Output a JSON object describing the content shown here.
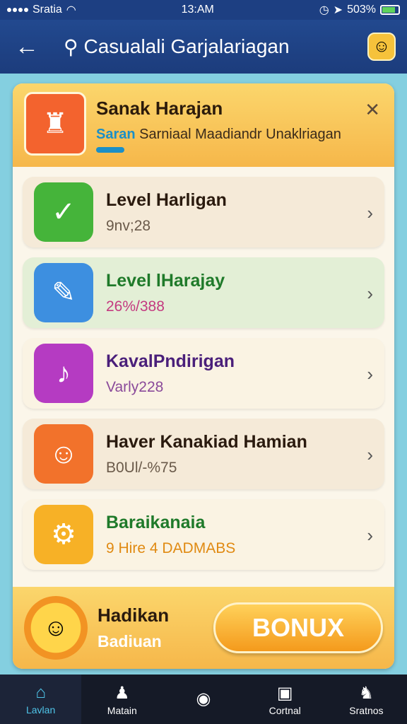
{
  "status_bar": {
    "carrier": "Sratia",
    "time": "13:AM",
    "battery": "503%"
  },
  "app_bar": {
    "title": "Casualali Garjalariagan"
  },
  "banner": {
    "title": "Sanak Harajan",
    "subtitle_accent": "Saran",
    "subtitle": "Sarniaal Maadiandr Unaklriagan"
  },
  "list": {
    "items": [
      {
        "title": "Level Harligan",
        "subtitle": "9nv;28",
        "bg": "#f5ead8",
        "icon_bg": "#45b43a",
        "title_color": "#2a1a0e",
        "sub_color": "#6a5a4a"
      },
      {
        "title": "Level lHarajay",
        "subtitle": "26%/388",
        "bg": "#e3efd6",
        "icon_bg": "#3d8fe0",
        "title_color": "#1f7a2a",
        "sub_color": "#c43a80"
      },
      {
        "title": "KavalPndirigan",
        "subtitle": "Varly228",
        "bg": "#faf3e3",
        "icon_bg": "#b53bc2",
        "title_color": "#4a1f7a",
        "sub_color": "#8a4a9a"
      },
      {
        "title": "Haver Kanakiad Hamian",
        "subtitle": "B0Ul/-%75",
        "bg": "#f5ead8",
        "icon_bg": "#f2722b",
        "title_color": "#2a1a0e",
        "sub_color": "#6a5a4a"
      },
      {
        "title": "Baraikanaia",
        "subtitle": "9 Hire 4 DADMABS",
        "bg": "#faf3e3",
        "icon_bg": "#f7b126",
        "title_color": "#1f7a2a",
        "sub_color": "#e08a12"
      }
    ]
  },
  "bonus": {
    "title": "Hadikan",
    "subtitle": "Badiuan",
    "button": "BONUX"
  },
  "bottom_nav": {
    "items": [
      {
        "label": "Lavlan"
      },
      {
        "label": "Matain"
      },
      {
        "label": ""
      },
      {
        "label": "Cortnal"
      },
      {
        "label": "Sratnos"
      }
    ]
  }
}
